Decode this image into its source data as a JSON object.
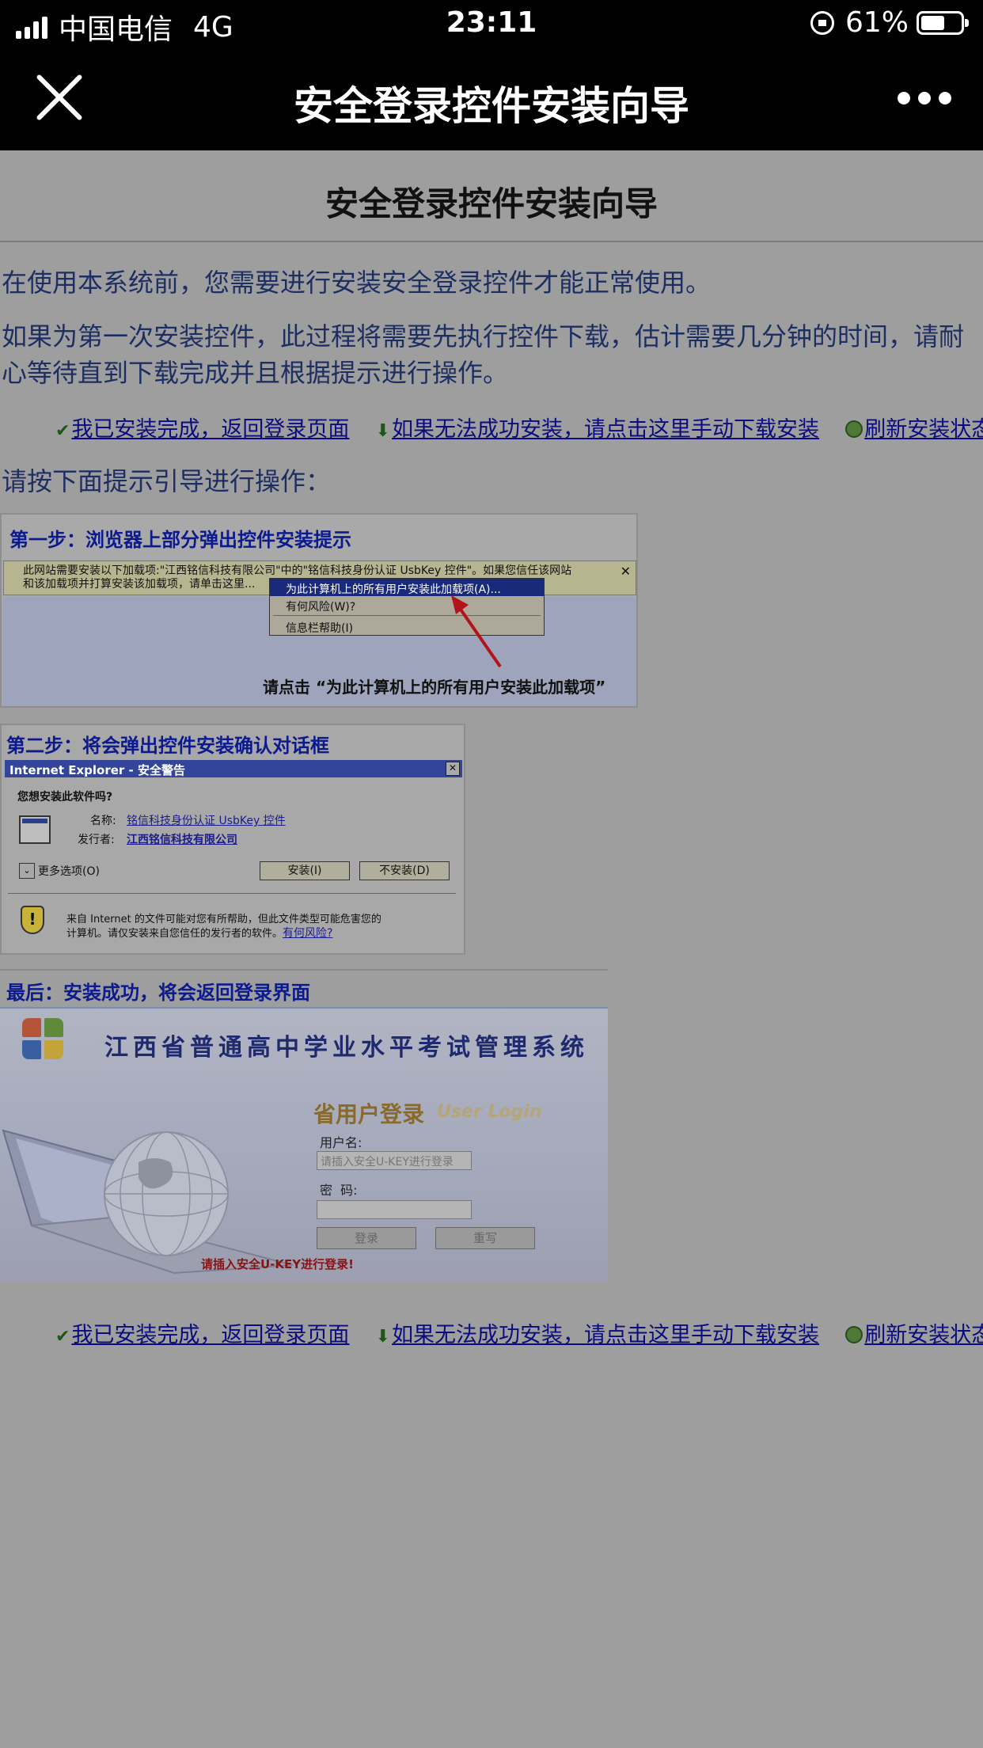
{
  "status_bar": {
    "carrier": "中国电信",
    "network": "4G",
    "time": "23:11",
    "battery": "61%",
    "battery_level": 0.61
  },
  "nav": {
    "title": "安全登录控件安装向导"
  },
  "page": {
    "title": "安全登录控件安装向导",
    "intro_1": "在使用本系统前，您需要进行安装安全登录控件才能正常使用。",
    "intro_2": "如果为第一次安装控件，此过程将需要先执行控件下载，估计需要几分钟的时间，请耐心等待直到下载完成并且根据提示进行操作。",
    "guide": "请按下面提示引导进行操作："
  },
  "links": {
    "done": "我已安装完成，返回登录页面",
    "manual": "如果无法成功安装，请点击这里手动下载安装",
    "refresh": "刷新安装状态"
  },
  "step1": {
    "heading": "第一步：浏览器上部分弹出控件安装提示",
    "infobar_line1": "此网站需要安装以下加载项:\"江西铭信科技有限公司\"中的\"铭信科技身份认证 UsbKey 控件\"。如果您信任该网站",
    "infobar_line2": "和该加载项并打算安装该加载项，请单击这里...",
    "infobar_close": "✕",
    "menu": [
      "为此计算机上的所有用户安装此加载项(A)...",
      "有何风险(W)?",
      "信息栏帮助(I)"
    ],
    "tip": "请点击 “为此计算机上的所有用户安装此加载项”"
  },
  "step2": {
    "heading": "第二步：将会弹出控件安装确认对话框",
    "dialog_title": "Internet Explorer - 安全警告",
    "dialog_close": "✕",
    "question": "您想安装此软件吗?",
    "name_label": "名称:",
    "name_value": "铭信科技身份认证 UsbKey 控件",
    "publisher_label": "发行者:",
    "publisher_value": "江西铭信科技有限公司",
    "more_options": "更多选项(O)",
    "install_button": "安装(I)",
    "dont_install_button": "不安装(D)",
    "warning_line1": "来自 Internet 的文件可能对您有所帮助，但此文件类型可能危害您的",
    "warning_line2": "计算机。请仅安装来自您信任的发行者的软件。",
    "risk_link": "有何风险?"
  },
  "step3": {
    "heading": "最后：安装成功，将会返回登录界面",
    "system_title": "江西省普通高中学业水平考试管理系统",
    "login_title": "省用户登录",
    "login_title_en": "User Login",
    "username_label": "用户名:",
    "username_placeholder": "请插入安全U-KEY进行登录",
    "password_label": "密  码:",
    "login_button": "登录",
    "reset_button": "重写",
    "warning": "请插入安全U-KEY进行登录!"
  }
}
